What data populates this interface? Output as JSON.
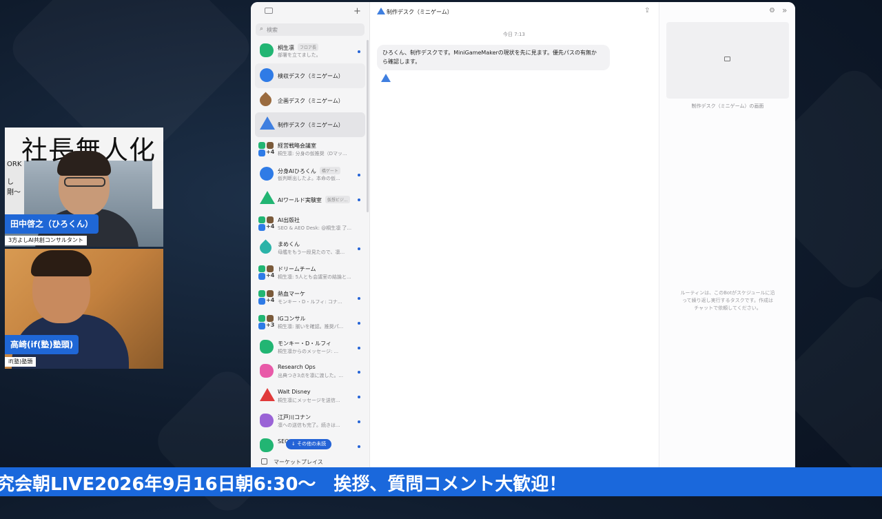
{
  "webcams": [
    {
      "name": "田中啓之（ひろくん）",
      "role": "3方よしAI共創コンサルタント",
      "banner": "社長無人化",
      "side_text": "ORK\nし\n剛〜"
    },
    {
      "name": "高崎(if(塾)塾頭)",
      "role": "if(塾)塾頭"
    }
  ],
  "app": {
    "search_placeholder": "検索",
    "conversations": [
      {
        "title": "桐生凛",
        "badge": "フロア長",
        "subtitle": "部署を立てました。",
        "unread": true,
        "avatar": "green-blob",
        "color": "#22b573"
      },
      {
        "title": "検収デスク（ミニゲーム）",
        "badge": "",
        "subtitle": "",
        "unread": false,
        "avatar": "blue-circle",
        "color": "#2f7be6"
      },
      {
        "title": "企画デスク（ミニゲーム）",
        "badge": "",
        "subtitle": "",
        "unread": false,
        "avatar": "brown-drop",
        "color": "#9a6b3f"
      },
      {
        "title": "制作デスク（ミニゲーム）",
        "badge": "",
        "subtitle": "",
        "unread": false,
        "avatar": "blue-triangle",
        "color": "#3f7fe0"
      },
      {
        "title": "経営戦略会議室",
        "badge": "",
        "subtitle": "桐生凛: 分身の仮推奨（Dマッ...",
        "unread": false,
        "avatar": "group",
        "group_count": "+4"
      },
      {
        "title": "分身AIひろくん",
        "badge": "橋ゲート",
        "subtitle": "仮判断出したよ。本命の仮...",
        "unread": true,
        "avatar": "blue-circle",
        "color": "#2f7be6"
      },
      {
        "title": "AIワールド実験室",
        "badge": "仮想ビジ...",
        "subtitle": "",
        "unread": true,
        "avatar": "green-triangle",
        "color": "#22b573"
      },
      {
        "title": "AI出版社",
        "badge": "",
        "subtitle": "SEO & AEO Desk: @桐生凛 了...",
        "unread": false,
        "avatar": "group",
        "group_count": "+4"
      },
      {
        "title": "まめくん",
        "badge": "",
        "subtitle": "母艦をもう一段見たので、凛...",
        "unread": true,
        "avatar": "teal-drop",
        "color": "#2bb3a8"
      },
      {
        "title": "ドリームチーム",
        "badge": "",
        "subtitle": "桐生凛: 5人とも会議室の結論と...",
        "unread": false,
        "avatar": "group",
        "group_count": "+4"
      },
      {
        "title": "熱血マーケ",
        "badge": "",
        "subtitle": "モンキー・D・ルフィ: コナ...",
        "unread": true,
        "avatar": "group",
        "group_count": "+4"
      },
      {
        "title": "IGコンサル",
        "badge": "",
        "subtitle": "桐生凛: 揃いを確認。推奨パ...",
        "unread": true,
        "avatar": "group",
        "group_count": "+3"
      },
      {
        "title": "モンキー・D・ルフィ",
        "badge": "",
        "subtitle": "桐生凛からのメッセージ: ...",
        "unread": true,
        "avatar": "green-blob",
        "color": "#22b573"
      },
      {
        "title": "Research Ops",
        "badge": "",
        "subtitle": "出典つき3点を凛に渡した。...",
        "unread": true,
        "avatar": "pink-blob",
        "color": "#e85aa8"
      },
      {
        "title": "Walt Disney",
        "badge": "",
        "subtitle": "桐生凛にメッセージを送信...",
        "unread": true,
        "avatar": "red-triangle",
        "color": "#e03a3a"
      },
      {
        "title": "江戸川コナン",
        "badge": "",
        "subtitle": "凛への送信も完了。続きは...",
        "unread": true,
        "avatar": "purple-blob",
        "color": "#9a63d6"
      },
      {
        "title": "SEO",
        "badge": "",
        "subtitle": "",
        "unread": true,
        "avatar": "green-blob",
        "color": "#22b573"
      }
    ],
    "unread_button": "↓ その他の未読",
    "marketplace": "マーケットプレイス",
    "chat": {
      "title": "制作デスク（ミニゲーム）",
      "time": "今日 7:13",
      "message_line1": "ひろくん、制作デスクです。MiniGameMakerの現状を先に見ます。優先パスの有無か",
      "message_line2": "ら確認します。"
    },
    "panel": {
      "preview_caption": "制作デスク（ミニゲーム）の画面",
      "routine_line1": "ルーティンは、このBotがスケジュールに沿",
      "routine_line2": "って繰り返し実行するタスクです。作成は",
      "routine_line3": "チャットで依頼してください。"
    }
  },
  "ticker": "究会朝LIVE2026年9月16日朝6:30〜　挨拶、質問コメント大歓迎！",
  "colors": {
    "accent": "#1a68dc",
    "unread_dot": "#2463d6",
    "name_tag": "#1f67d6"
  }
}
